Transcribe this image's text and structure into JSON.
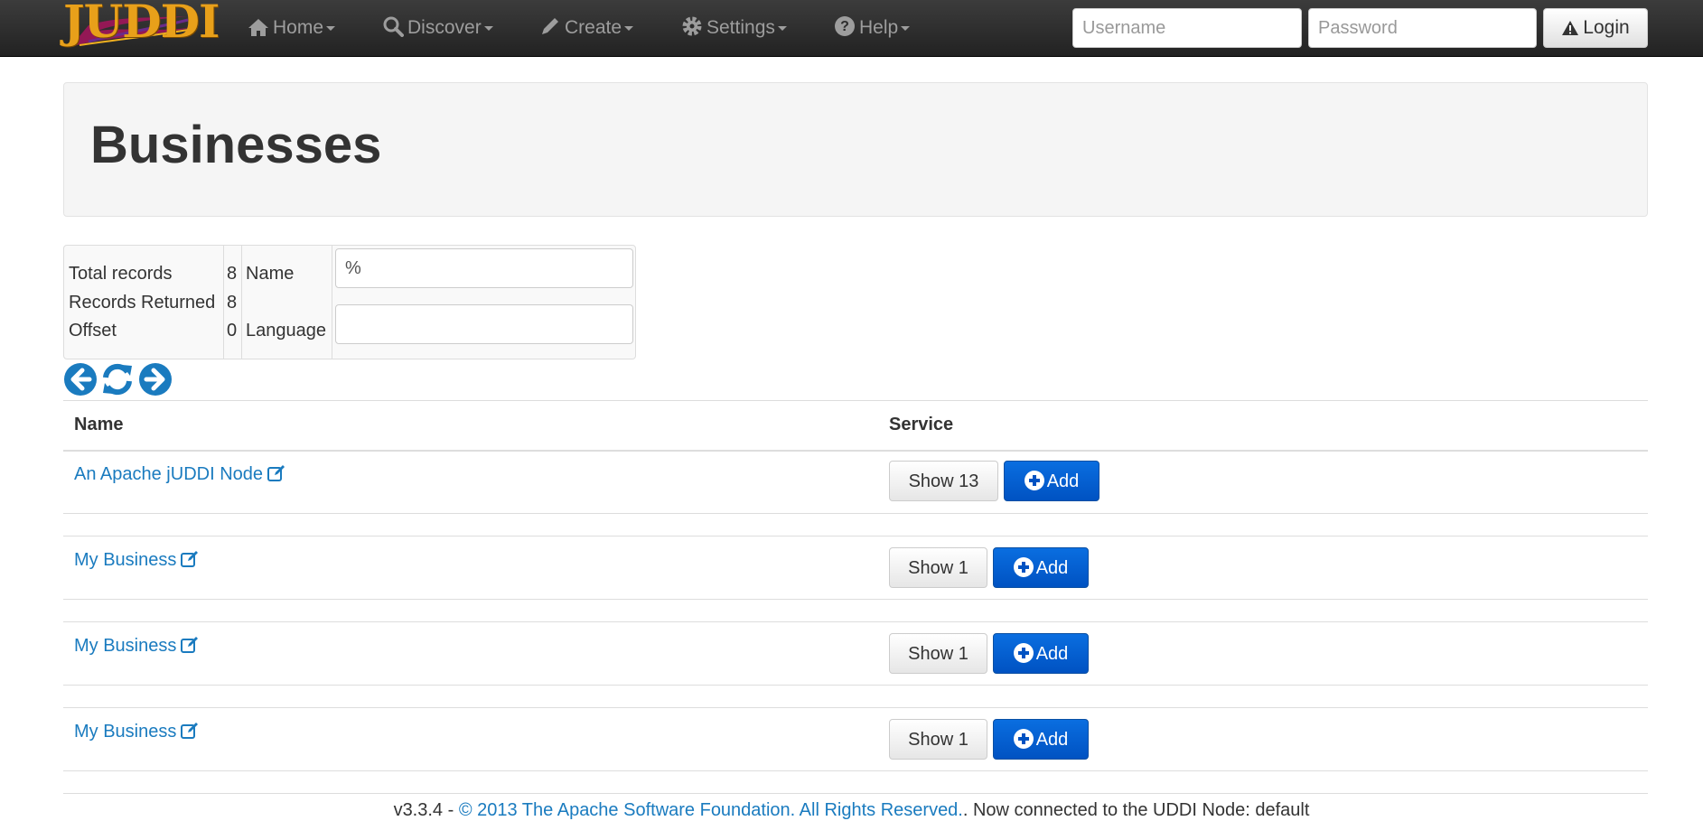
{
  "navbar": {
    "brand": "JUDDI",
    "items": [
      {
        "label": "Home",
        "icon": "home-icon"
      },
      {
        "label": "Discover",
        "icon": "search-icon"
      },
      {
        "label": "Create",
        "icon": "pencil-icon"
      },
      {
        "label": "Settings",
        "icon": "gear-icon"
      },
      {
        "label": "Help",
        "icon": "question-circle-icon"
      }
    ],
    "username_placeholder": "Username",
    "password_placeholder": "Password",
    "login_label": "Login"
  },
  "page": {
    "title": "Businesses"
  },
  "stats": {
    "total_records_label": "Total records",
    "total_records": "8",
    "records_returned_label": "Records Returned",
    "records_returned": "8",
    "offset_label": "Offset",
    "offset": "0",
    "name_label": "Name",
    "name_value": "%",
    "language_label": "Language",
    "language_value": ""
  },
  "table": {
    "col_name": "Name",
    "col_service": "Service",
    "add_label": "Add",
    "rows": [
      {
        "name": "An Apache jUDDI Node",
        "show": "Show 13"
      },
      {
        "name": "My Business",
        "show": "Show 1"
      },
      {
        "name": "My Business",
        "show": "Show 1"
      },
      {
        "name": "My Business",
        "show": "Show 1"
      }
    ]
  },
  "footer": {
    "version": "v3.3.4 - ",
    "copyright": "© 2013 The Apache Software Foundation. All Rights Reserved.",
    "status": ". Now connected to the UDDI Node: default"
  },
  "colors": {
    "navbar": "#222222",
    "link": "#1a7bbf",
    "primary": "#0052c2",
    "brand": "#e8a01a"
  }
}
